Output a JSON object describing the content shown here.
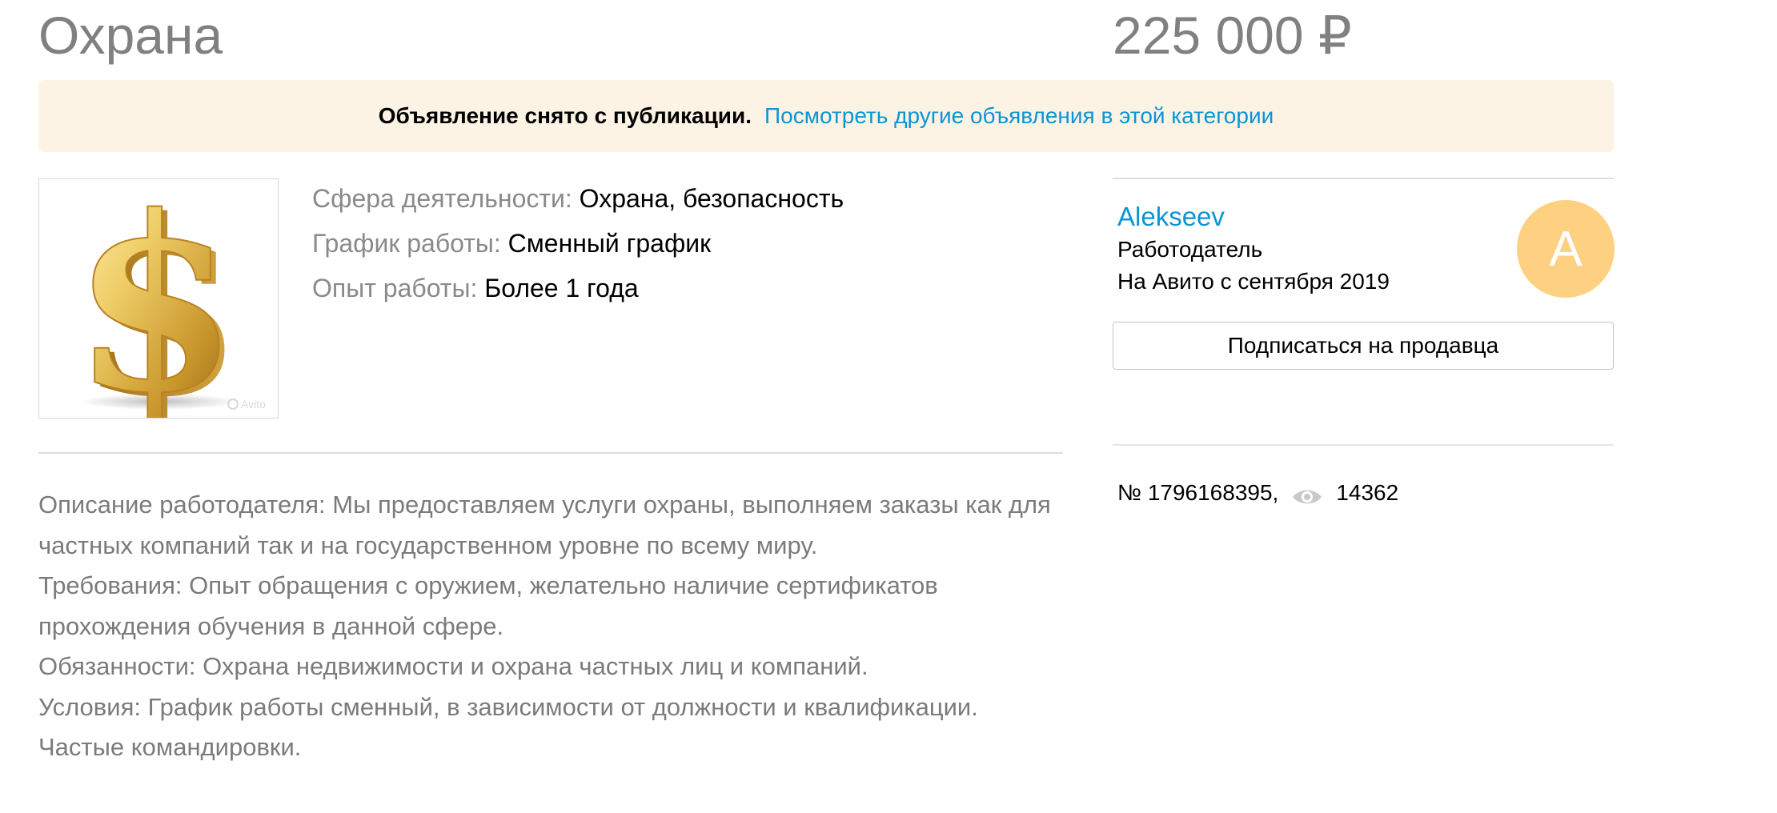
{
  "listing": {
    "title": "Охрана",
    "price": "225 000 ₽"
  },
  "notice": {
    "status_text": "Объявление снято с публикации.",
    "link_text": "Посмотреть другие объявления в этой категории"
  },
  "photo": {
    "icon": "dollar-sign-icon",
    "watermark": "Avito"
  },
  "params": [
    {
      "key": "Сфера деятельности:",
      "value": "Охрана, безопасность"
    },
    {
      "key": "График работы:",
      "value": "Сменный график"
    },
    {
      "key": "Опыт работы:",
      "value": "Более 1 года"
    }
  ],
  "description": [
    "Описание работодателя: Мы предоставляем услуги охраны, выполняем заказы как для частных компаний так и на государственном уровне по всему миру.",
    "Требования: Опыт обращения с оружием, желательно наличие сертификатов прохождения обучения в данной сфере.",
    "Обязанности: Охрана недвижимости и охрана частных лиц и компаний.",
    "Условия: График работы сменный, в зависимости от должности и квалификации.",
    "Частые командировки."
  ],
  "seller": {
    "name": "Alekseev",
    "role": "Работодатель",
    "since": "На Авито с сентября 2019",
    "avatar_letter": "A",
    "avatar_color": "#fdd181",
    "subscribe_label": "Подписаться на продавца"
  },
  "meta": {
    "item_number": "№ 1796168395,",
    "views_icon": "eye-icon",
    "views": "14362"
  },
  "colors": {
    "link": "#0a95d5",
    "notice_bg": "#fdf3e4",
    "muted_text": "#808080"
  }
}
